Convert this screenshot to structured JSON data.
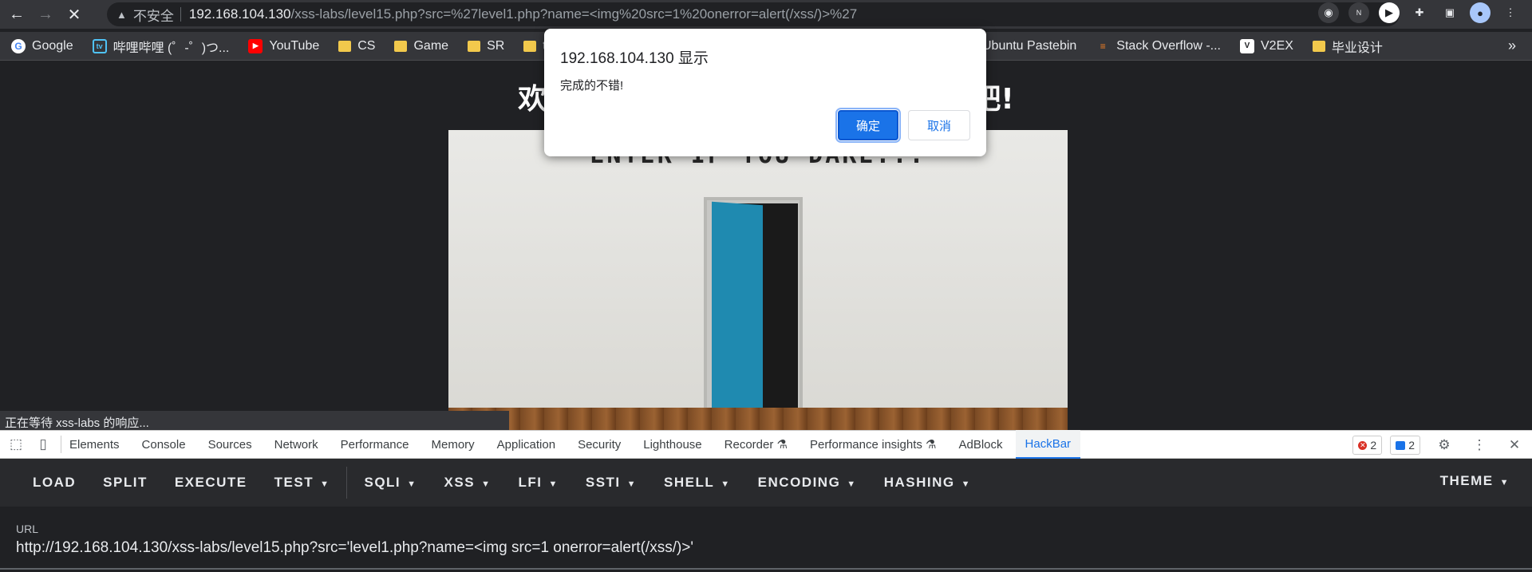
{
  "browser": {
    "insecure_label": "不安全",
    "url_host": "192.168.104.130",
    "url_path": "/xss-labs/level15.php?src=%27level1.php?name=<img%20src=1%20onerror=alert(/xss/)>%27",
    "bookmarks": [
      "Google",
      "哔哩哔哩 (゜-゜)つ...",
      "YouTube",
      "CS",
      "Game",
      "SR",
      "tu",
      "...",
      "Ubuntu Pastebin",
      "Stack Overflow -...",
      "V2EX",
      "毕业设计"
    ],
    "bookmarks_more": "»"
  },
  "page": {
    "title": "欢迎来到level15, 想个办法走出去吧!",
    "door_sign": "ENTER IF YOU DARE...",
    "status_text": "正在等待 xss-labs 的响应..."
  },
  "dialog": {
    "title": "192.168.104.130 显示",
    "message": "完成的不错!",
    "ok_label": "确定",
    "cancel_label": "取消"
  },
  "devtools": {
    "tabs": [
      "Elements",
      "Console",
      "Sources",
      "Network",
      "Performance",
      "Memory",
      "Application",
      "Security",
      "Lighthouse",
      "Recorder ⚗",
      "Performance insights ⚗",
      "AdBlock",
      "HackBar"
    ],
    "active_tab": "HackBar",
    "error_count": "2",
    "message_count": "2"
  },
  "hackbar": {
    "menu": [
      "LOAD",
      "SPLIT",
      "EXECUTE",
      "TEST",
      "SQLI",
      "XSS",
      "LFI",
      "SSTI",
      "SHELL",
      "ENCODING",
      "HASHING"
    ],
    "theme_label": "THEME",
    "url_label": "URL",
    "url_value": "http://192.168.104.130/xss-labs/level15.php?src='level1.php?name=<img src=1 onerror=alert(/xss/)>'"
  },
  "colors": {
    "accent": "#1a73e8",
    "chrome_bg": "#35363a",
    "door_blue": "#1f8ab0"
  }
}
